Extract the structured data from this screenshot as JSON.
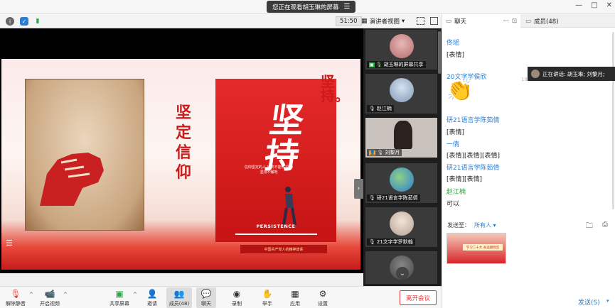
{
  "window": {
    "share_banner": "您正在观看胡玉琳的屏幕",
    "controls": [
      "—",
      "□",
      "✕"
    ]
  },
  "toolbar_top": {
    "timer": "51:50",
    "view_label": "演讲者视图"
  },
  "slide": {
    "vertical_text": "坚定信仰",
    "poster_title": "坚持",
    "poster_subtitle": "信仰坚定的人 始终不能不 坚持 坚持不懈地",
    "poster_english": "PERSISTENCE",
    "corner_text": "坚持。",
    "banner_text": "中国共产党人的精神谱系"
  },
  "video_tiles": [
    {
      "name": "胡玉琳的屏幕共享",
      "badge": "share"
    },
    {
      "name": "赵江楠",
      "badge": "none"
    },
    {
      "name": "刘黎月",
      "badge": "user"
    },
    {
      "name": "研21语言学陈茹倩",
      "badge": "none"
    },
    {
      "name": "21文字学罗默翰",
      "badge": "none"
    },
    {
      "name": "",
      "badge": "none"
    }
  ],
  "bottom_toolbar": {
    "mute": "解除静音",
    "video": "开启视频",
    "share": "共享屏幕",
    "invite": "邀请",
    "members": "成员(48)",
    "chat": "聊天",
    "record": "录制",
    "raise_hand": "举手",
    "apps": "应用",
    "settings": "设置",
    "leave": "离开会议"
  },
  "panel": {
    "tab_chat": "聊天",
    "tab_more": "···",
    "tab_members": "成员(48)",
    "messages": [
      {
        "kind": "name",
        "text": "佟瑶",
        "color": "blue"
      },
      {
        "kind": "text",
        "text": "[表情]"
      },
      {
        "kind": "name",
        "text": "20文字学侯欣",
        "color": "blue"
      },
      {
        "kind": "emoji",
        "text": "👏"
      },
      {
        "kind": "name",
        "text": "研21语言学陈茹倩",
        "color": "blue"
      },
      {
        "kind": "text",
        "text": "[表情]"
      },
      {
        "kind": "name",
        "text": "一倩",
        "color": "blue"
      },
      {
        "kind": "text",
        "text": "[表情][表情][表情]"
      },
      {
        "kind": "name",
        "text": "研21语言学陈茹倩",
        "color": "blue"
      },
      {
        "kind": "text",
        "text": "[表情][表情]"
      },
      {
        "kind": "name",
        "text": "赵江楠",
        "color": "green"
      },
      {
        "kind": "text",
        "text": "可以"
      }
    ],
    "toast": "正在讲话: 胡玉琳; 刘黎月;",
    "timestamp_fragment": "19",
    "send_to_label": "发送至：",
    "send_to_value": "所有人 ▾",
    "preview_text": "学习二十大 永远跟党走",
    "send_button": "发送(S)"
  },
  "colors": {
    "accent_blue": "#2a7dd1",
    "leave_red": "#e23a3a",
    "speaker_green": "#29a845"
  }
}
